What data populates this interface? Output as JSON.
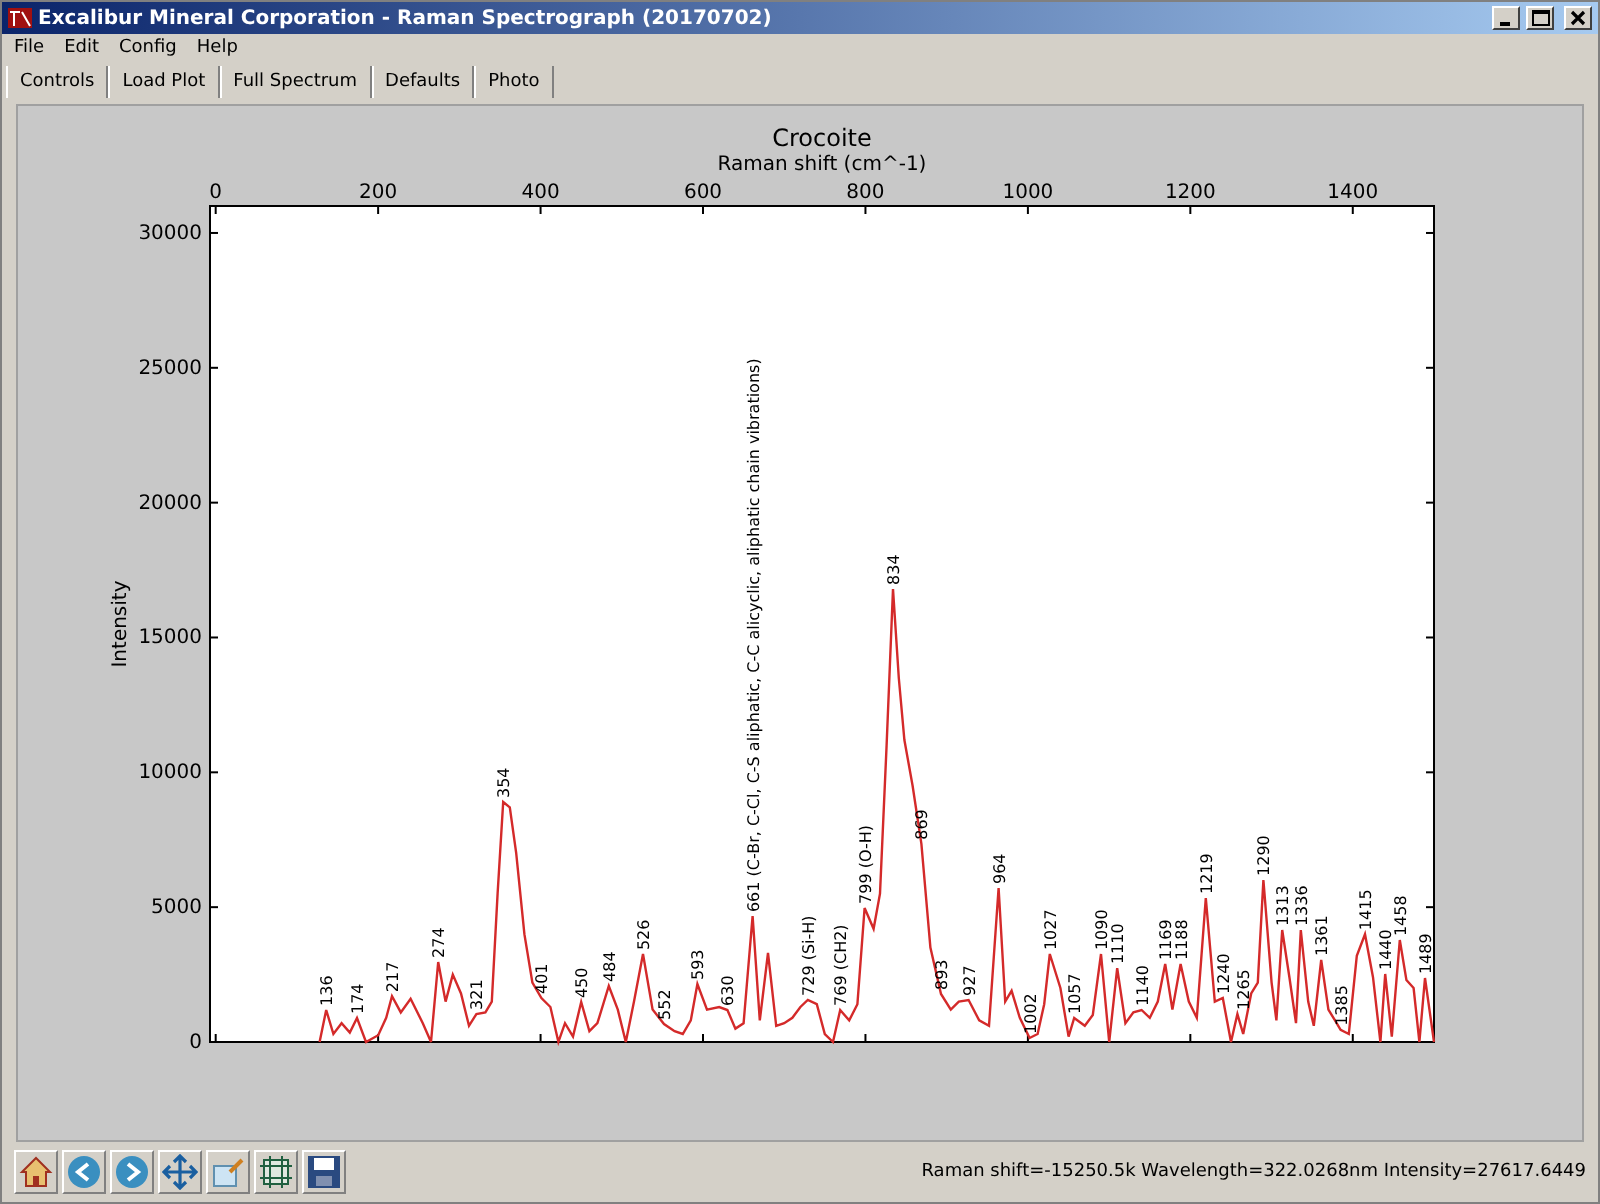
{
  "window": {
    "title": "Excalibur Mineral Corporation - Raman Spectrograph (20170702)"
  },
  "menu": [
    "File",
    "Edit",
    "Config",
    "Help"
  ],
  "tabs": [
    {
      "label": "Controls",
      "selected": false
    },
    {
      "label": "Load Plot",
      "selected": false
    },
    {
      "label": "Full Spectrum",
      "selected": false
    },
    {
      "label": "Defaults",
      "selected": false
    },
    {
      "label": "Photo",
      "selected": false
    }
  ],
  "plot": {
    "chart_data": {
      "type": "line",
      "title": "Crocoite",
      "xlabel": "Raman shift (cm^-1)",
      "ylabel": "Intensity",
      "xlim": [
        -7,
        1500
      ],
      "ylim": [
        0,
        31000
      ],
      "xticks": [
        0,
        200,
        400,
        600,
        800,
        1000,
        1200,
        1400
      ],
      "yticks": [
        0,
        5000,
        10000,
        15000,
        20000,
        25000,
        30000
      ],
      "x": [
        128,
        136,
        145,
        155,
        165,
        174,
        185,
        200,
        210,
        217,
        228,
        240,
        255,
        265,
        274,
        283,
        292,
        302,
        312,
        321,
        332,
        340,
        347,
        354,
        362,
        370,
        380,
        390,
        401,
        412,
        422,
        430,
        440,
        450,
        460,
        470,
        484,
        495,
        505,
        515,
        526,
        538,
        552,
        565,
        575,
        585,
        593,
        605,
        620,
        630,
        640,
        650,
        661,
        670,
        680,
        690,
        700,
        710,
        720,
        729,
        740,
        750,
        760,
        769,
        780,
        790,
        799,
        810,
        818,
        826,
        834,
        841,
        848,
        858,
        869,
        880,
        893,
        905,
        915,
        927,
        940,
        952,
        964,
        972,
        980,
        990,
        1002,
        1012,
        1020,
        1027,
        1040,
        1050,
        1057,
        1070,
        1080,
        1090,
        1100,
        1110,
        1120,
        1130,
        1140,
        1150,
        1160,
        1169,
        1178,
        1188,
        1198,
        1208,
        1219,
        1230,
        1240,
        1250,
        1258,
        1265,
        1275,
        1283,
        1290,
        1300,
        1306,
        1313,
        1322,
        1330,
        1336,
        1345,
        1352,
        1361,
        1370,
        1378,
        1385,
        1395,
        1405,
        1415,
        1425,
        1434,
        1440,
        1448,
        1458,
        1466,
        1475,
        1482,
        1489,
        1500
      ],
      "series": [
        {
          "color": "#d42a2a",
          "values": [
            0,
            1190,
            300,
            700,
            350,
            890,
            0,
            250,
            900,
            1700,
            1100,
            1600,
            700,
            0,
            2970,
            1500,
            2500,
            1800,
            600,
            1040,
            1100,
            1500,
            5500,
            8900,
            8700,
            7000,
            4000,
            2200,
            1630,
            1300,
            0,
            700,
            200,
            1480,
            400,
            700,
            2080,
            1200,
            0,
            1500,
            3260,
            1200,
            670,
            400,
            300,
            800,
            2150,
            1200,
            1300,
            1190,
            500,
            700,
            4670,
            800,
            3300,
            600,
            700,
            900,
            1300,
            1560,
            1400,
            300,
            0,
            1190,
            800,
            1400,
            4970,
            4200,
            5500,
            11000,
            16800,
            13500,
            11200,
            9500,
            7350,
            3500,
            1780,
            1200,
            1500,
            1560,
            800,
            600,
            5710,
            1500,
            1900,
            900,
            150,
            300,
            1400,
            3260,
            2000,
            200,
            890,
            600,
            1000,
            3260,
            0,
            2740,
            700,
            1100,
            1190,
            900,
            1500,
            2890,
            1200,
            2890,
            1500,
            900,
            5340,
            1500,
            1630,
            0,
            1040,
            300,
            1800,
            2200,
            6010,
            2200,
            800,
            4150,
            2400,
            700,
            4150,
            1500,
            600,
            3040,
            1200,
            800,
            450,
            300,
            3200,
            4000,
            2400,
            0,
            2520,
            200,
            3780,
            2300,
            2000,
            0,
            2370,
            0
          ]
        }
      ],
      "annotations": [
        {
          "x": 136,
          "y": 1190,
          "text": "136"
        },
        {
          "x": 174,
          "y": 890,
          "text": "174"
        },
        {
          "x": 217,
          "y": 1700,
          "text": "217"
        },
        {
          "x": 274,
          "y": 2970,
          "text": "274"
        },
        {
          "x": 321,
          "y": 1040,
          "text": "321"
        },
        {
          "x": 354,
          "y": 8900,
          "text": "354"
        },
        {
          "x": 401,
          "y": 1630,
          "text": "401"
        },
        {
          "x": 450,
          "y": 1480,
          "text": "450"
        },
        {
          "x": 484,
          "y": 2080,
          "text": "484"
        },
        {
          "x": 526,
          "y": 3260,
          "text": "526"
        },
        {
          "x": 552,
          "y": 670,
          "text": "552"
        },
        {
          "x": 593,
          "y": 2150,
          "text": "593"
        },
        {
          "x": 630,
          "y": 1190,
          "text": "630"
        },
        {
          "x": 661,
          "y": 4670,
          "text": "661 (C-Br, C-Cl, C-S aliphatic, C-C alicyclic, aliphatic chain vibrations)"
        },
        {
          "x": 729,
          "y": 1560,
          "text": "729 (Si-H)"
        },
        {
          "x": 769,
          "y": 1190,
          "text": "769 (CH2)"
        },
        {
          "x": 799,
          "y": 4970,
          "text": "799 (O-H)"
        },
        {
          "x": 834,
          "y": 16800,
          "text": "834"
        },
        {
          "x": 869,
          "y": 7350,
          "text": "869"
        },
        {
          "x": 893,
          "y": 1780,
          "text": "893"
        },
        {
          "x": 927,
          "y": 1560,
          "text": "927"
        },
        {
          "x": 964,
          "y": 5710,
          "text": "964"
        },
        {
          "x": 1002,
          "y": 150,
          "text": "1002"
        },
        {
          "x": 1027,
          "y": 3260,
          "text": "1027"
        },
        {
          "x": 1057,
          "y": 890,
          "text": "1057"
        },
        {
          "x": 1090,
          "y": 3260,
          "text": "1090"
        },
        {
          "x": 1110,
          "y": 2740,
          "text": "1110"
        },
        {
          "x": 1140,
          "y": 1190,
          "text": "1140"
        },
        {
          "x": 1169,
          "y": 2890,
          "text": "1169"
        },
        {
          "x": 1188,
          "y": 2890,
          "text": "1188"
        },
        {
          "x": 1219,
          "y": 5340,
          "text": "1219"
        },
        {
          "x": 1240,
          "y": 1630,
          "text": "1240"
        },
        {
          "x": 1265,
          "y": 1040,
          "text": "1265"
        },
        {
          "x": 1290,
          "y": 6010,
          "text": "1290"
        },
        {
          "x": 1313,
          "y": 4150,
          "text": "1313"
        },
        {
          "x": 1336,
          "y": 4150,
          "text": "1336"
        },
        {
          "x": 1361,
          "y": 3040,
          "text": "1361"
        },
        {
          "x": 1385,
          "y": 450,
          "text": "1385"
        },
        {
          "x": 1415,
          "y": 4000,
          "text": "1415"
        },
        {
          "x": 1440,
          "y": 2520,
          "text": "1440"
        },
        {
          "x": 1458,
          "y": 3780,
          "text": "1458"
        },
        {
          "x": 1489,
          "y": 2370,
          "text": "1489"
        }
      ]
    }
  },
  "toolbar": [
    {
      "kind": "home"
    },
    {
      "kind": "back"
    },
    {
      "kind": "forward"
    },
    {
      "kind": "pan"
    },
    {
      "kind": "zoom"
    },
    {
      "kind": "subplots"
    },
    {
      "kind": "save"
    }
  ],
  "status": "Raman shift=-15250.5k Wavelength=322.0268nm Intensity=27617.6449"
}
